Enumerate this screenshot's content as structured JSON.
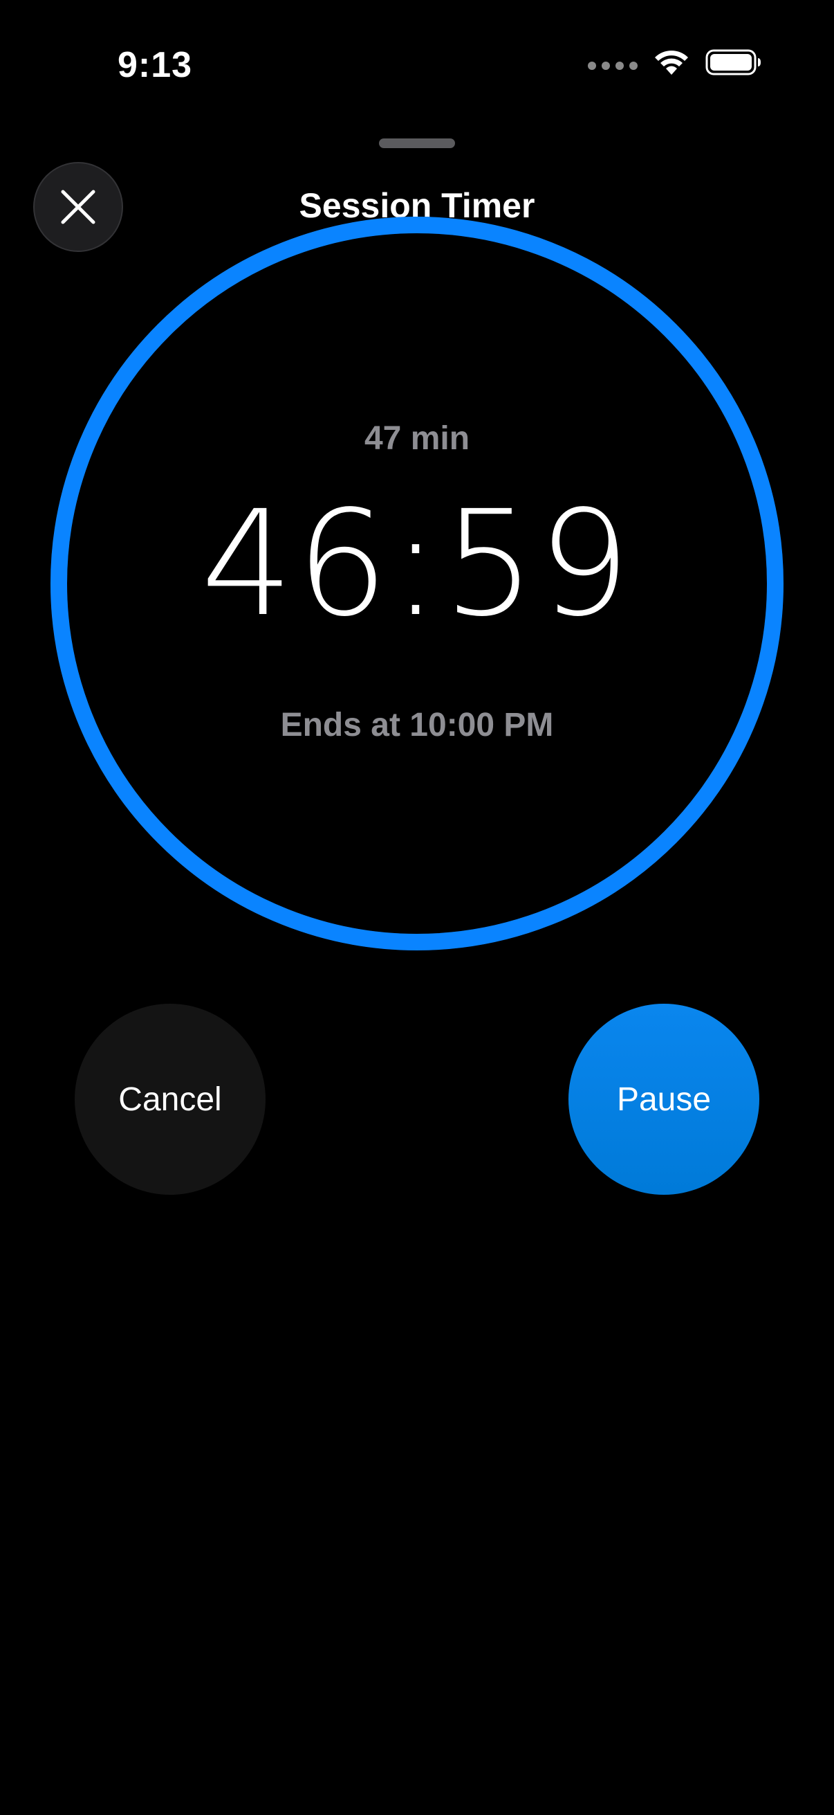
{
  "status_bar": {
    "time": "9:13"
  },
  "sheet": {
    "title": "Session Timer"
  },
  "timer": {
    "duration_label": "47 min",
    "countdown": "46:59",
    "ends_label": "Ends at 10:00 PM",
    "progress_fraction": 1.0,
    "ring_color": "#0a84ff"
  },
  "actions": {
    "cancel_label": "Cancel",
    "pause_label": "Pause"
  },
  "icons": {
    "close": "close-icon",
    "wifi": "wifi-icon",
    "battery": "battery-icon",
    "signal": "cellular-signal-icon"
  }
}
